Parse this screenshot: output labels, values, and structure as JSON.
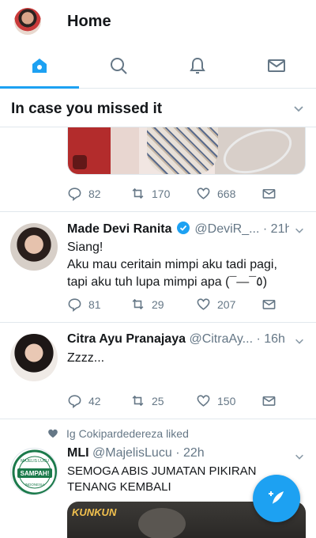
{
  "header": {
    "title": "Home"
  },
  "tabs": [
    {
      "icon": "home-icon",
      "active": true
    },
    {
      "icon": "search-icon",
      "active": false
    },
    {
      "icon": "bell-icon",
      "active": false
    },
    {
      "icon": "mail-icon",
      "active": false
    }
  ],
  "colors": {
    "accent": "#1da1f2",
    "muted": "#657786",
    "divider": "#e1e8ed"
  },
  "section": {
    "title": "In case you missed it"
  },
  "tweets": [
    {
      "replies": "82",
      "retweets": "170",
      "likes": "668"
    },
    {
      "name": "Made Devi Ranita",
      "handle": "@DeviR_...",
      "time": "· 21h",
      "verified": true,
      "line1": "Siang!",
      "line2": "Aku mau ceritain mimpi aku tadi pagi,",
      "line3": "tapi aku tuh lupa mimpi apa (¯―¯٥)",
      "replies": "81",
      "retweets": "29",
      "likes": "207"
    },
    {
      "name": "Citra Ayu Pranajaya",
      "handle": "@CitraAy...",
      "time": "· 16h",
      "line1": "Zzzz...",
      "replies": "42",
      "retweets": "25",
      "likes": "150"
    },
    {
      "liked_by": "Ig Cokipardedereza liked",
      "name": "MLI",
      "handle": "@MajelisLucu",
      "time": "· 22h",
      "line1": "SEMOGA ABIS JUMATAN PIKIRAN",
      "line2": "TENANG KEMBALI",
      "avatar_text": "SAMPAH!",
      "avatar_top": "MAJELIS LUCU",
      "avatar_bottom": "INDONESIA",
      "media_label": "KUNKUN"
    }
  ]
}
